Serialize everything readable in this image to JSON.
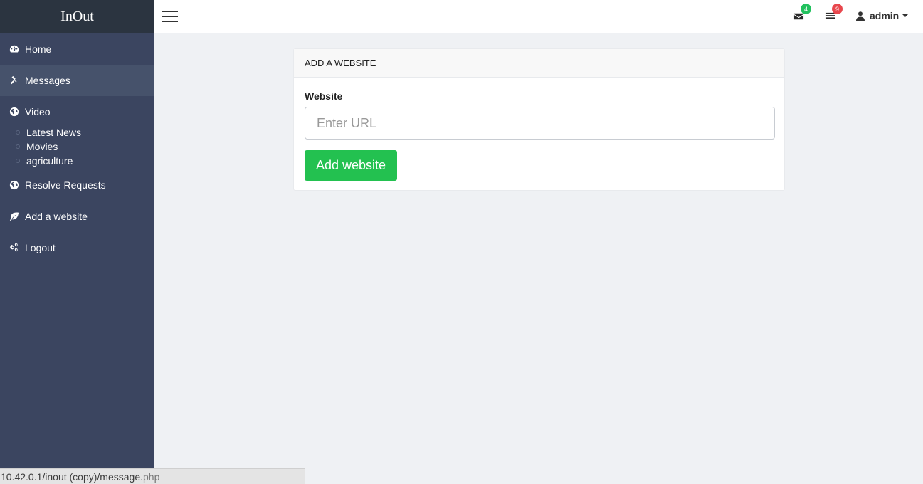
{
  "app": {
    "brand": "InOut"
  },
  "sidebar": {
    "items": [
      {
        "label": "Home",
        "icon": "dashboard-icon"
      },
      {
        "label": "Messages",
        "icon": "gavel-icon",
        "active": true
      },
      {
        "label": "Video",
        "icon": "globe-icon"
      },
      {
        "label": "Resolve Requests",
        "icon": "globe-icon"
      },
      {
        "label": "Add a website",
        "icon": "leaf-icon"
      },
      {
        "label": "Logout",
        "icon": "gears-icon"
      }
    ],
    "video_submenu": [
      "Latest News",
      "Movies",
      "agriculture"
    ]
  },
  "topbar": {
    "menu_icon": "hamburger-icon",
    "messages_badge": "4",
    "messages_badge_color": "#22c15e",
    "tasks_badge": "9",
    "tasks_badge_color": "#e8474d",
    "user_name": "admin"
  },
  "panel": {
    "title": "ADD A WEBSITE",
    "field_label": "Website",
    "input_value": "",
    "input_placeholder": "Enter URL",
    "submit_label": "Add website",
    "submit_color": "#23c150"
  },
  "statusbar": {
    "url": "10.42.0.1/inout (copy)/message.",
    "url_ext": "php"
  }
}
